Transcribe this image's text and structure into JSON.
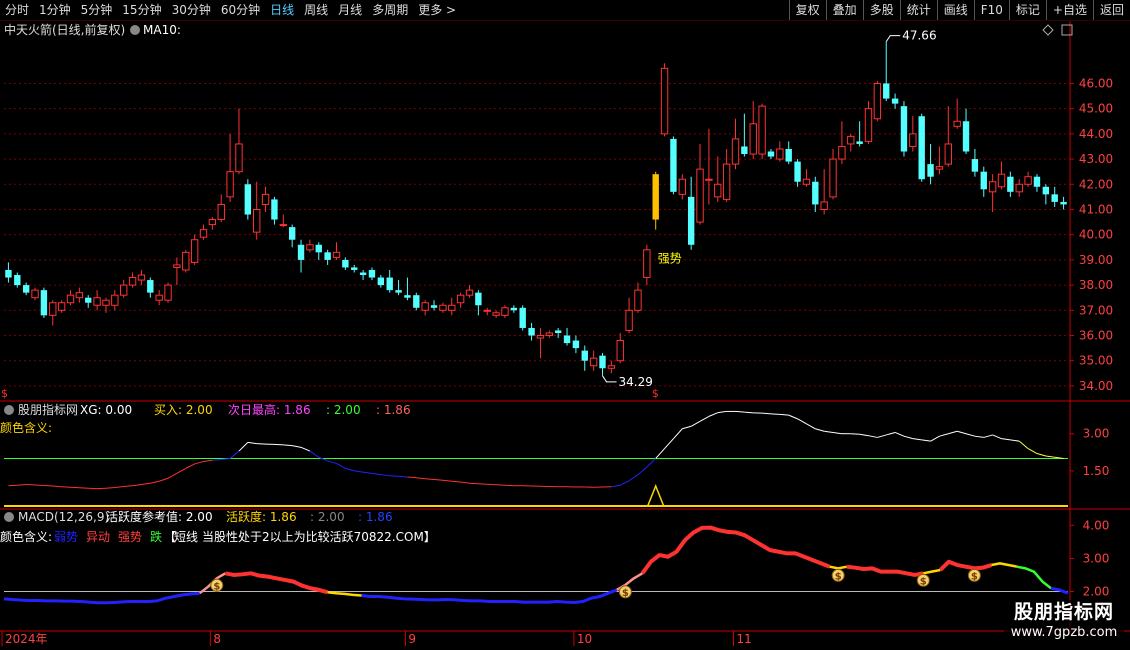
{
  "toolbar": {
    "periods": [
      "分时",
      "1分钟",
      "5分钟",
      "15分钟",
      "30分钟",
      "60分钟",
      "日线",
      "周线",
      "月线",
      "多周期",
      "更多"
    ],
    "active": "日线",
    "more_arrow": ">",
    "tools": [
      "复权",
      "叠加",
      "多股",
      "统计",
      "画线",
      "F10",
      "标记",
      "+自选",
      "返回"
    ]
  },
  "colors": {
    "up": "#ff3232",
    "down": "#54ffff",
    "bg": "#000000",
    "grid": "#7a0000",
    "axis": "#cc0000",
    "white": "#ffffff",
    "yellow": "#ffd700",
    "green": "#33ff33",
    "blue": "#2222ff",
    "pink": "#ff9090",
    "magenta": "#ff44ff"
  },
  "watermark": {
    "title": "股朋指标网",
    "url": "www.7gpzb.com"
  },
  "chart_data": [
    {
      "type": "candlestick",
      "title": "中天火箭(日线,前复权)",
      "ma_label": "MA10:",
      "ylim": [
        33.6,
        48.2
      ],
      "y_ticks": [
        34,
        35,
        36,
        37,
        38,
        39,
        40,
        41,
        42,
        43,
        44,
        45,
        46
      ],
      "high_label": "47.66",
      "low_label": "34.29",
      "signal_label": "强势",
      "dollar_marker": "$",
      "x_labels": [
        "2024年",
        "8",
        "9",
        "10",
        "11"
      ],
      "x_label_index": [
        0,
        23,
        45,
        64,
        82
      ],
      "candles": [
        [
          38.6,
          38.3,
          38.9,
          38.1
        ],
        [
          38.4,
          38.0,
          38.5,
          37.9
        ],
        [
          38.0,
          37.7,
          38.1,
          37.6
        ],
        [
          37.5,
          37.8,
          37.9,
          37.4
        ],
        [
          37.8,
          36.8,
          37.9,
          36.7
        ],
        [
          36.8,
          37.3,
          37.4,
          36.4
        ],
        [
          37.0,
          37.3,
          37.4,
          36.9
        ],
        [
          37.3,
          37.6,
          37.8,
          37.2
        ],
        [
          37.5,
          37.7,
          37.9,
          37.3
        ],
        [
          37.5,
          37.3,
          37.6,
          37.1
        ],
        [
          37.2,
          37.5,
          37.8,
          37.0
        ],
        [
          37.2,
          37.4,
          37.5,
          36.9
        ],
        [
          37.2,
          37.6,
          37.8,
          37.0
        ],
        [
          37.6,
          38.0,
          38.2,
          37.5
        ],
        [
          38.0,
          38.3,
          38.5,
          37.9
        ],
        [
          38.2,
          38.4,
          38.6,
          38.0
        ],
        [
          38.2,
          37.7,
          38.3,
          37.5
        ],
        [
          37.4,
          37.6,
          37.8,
          37.2
        ],
        [
          37.4,
          38.0,
          38.1,
          37.3
        ],
        [
          38.7,
          38.8,
          39.1,
          38.0
        ],
        [
          38.6,
          39.3,
          39.4,
          38.5
        ],
        [
          38.9,
          39.8,
          40.0,
          38.8
        ],
        [
          39.9,
          40.2,
          40.4,
          39.8
        ],
        [
          40.4,
          40.6,
          40.7,
          40.2
        ],
        [
          40.6,
          41.2,
          41.6,
          40.5
        ],
        [
          41.5,
          42.5,
          44.0,
          41.3
        ],
        [
          42.5,
          43.6,
          45.0,
          42.4
        ],
        [
          42.0,
          40.8,
          42.2,
          40.6
        ],
        [
          40.1,
          41.0,
          42.1,
          39.8
        ],
        [
          41.2,
          41.6,
          41.9,
          40.9
        ],
        [
          41.4,
          40.6,
          41.5,
          40.4
        ],
        [
          40.4,
          40.4,
          40.8,
          40.3
        ],
        [
          40.3,
          39.8,
          40.4,
          39.5
        ],
        [
          39.6,
          39.0,
          39.8,
          38.5
        ],
        [
          39.4,
          39.6,
          39.8,
          39.3
        ],
        [
          39.6,
          39.3,
          39.7,
          39.0
        ],
        [
          39.3,
          39.0,
          39.4,
          38.8
        ],
        [
          39.1,
          39.3,
          39.7,
          39.0
        ],
        [
          39.0,
          38.7,
          39.1,
          38.6
        ],
        [
          38.7,
          38.6,
          38.8,
          38.5
        ],
        [
          38.5,
          38.4,
          38.6,
          38.2
        ],
        [
          38.6,
          38.3,
          38.7,
          38.2
        ],
        [
          38.3,
          38.0,
          38.4,
          37.9
        ],
        [
          38.3,
          37.8,
          38.6,
          37.7
        ],
        [
          37.8,
          37.7,
          38.2,
          37.6
        ],
        [
          37.6,
          37.5,
          38.3,
          37.4
        ],
        [
          37.6,
          37.1,
          37.7,
          37.0
        ],
        [
          37.0,
          37.3,
          37.4,
          36.8
        ],
        [
          37.2,
          37.1,
          37.4,
          37.0
        ],
        [
          37.0,
          37.2,
          37.3,
          36.9
        ],
        [
          37.0,
          37.2,
          37.5,
          36.8
        ],
        [
          37.3,
          37.6,
          37.7,
          37.1
        ],
        [
          37.6,
          37.8,
          38.0,
          37.5
        ],
        [
          37.7,
          37.2,
          37.8,
          36.8
        ],
        [
          37.0,
          37.0,
          37.1,
          36.8
        ],
        [
          36.8,
          36.9,
          37.0,
          36.7
        ],
        [
          36.8,
          37.1,
          37.2,
          36.7
        ],
        [
          37.1,
          37.0,
          37.2,
          36.9
        ],
        [
          37.1,
          36.3,
          37.2,
          36.2
        ],
        [
          36.3,
          36.0,
          36.5,
          35.8
        ],
        [
          35.9,
          36.0,
          36.3,
          35.1
        ],
        [
          36.0,
          36.1,
          36.2,
          35.9
        ],
        [
          36.2,
          36.1,
          36.3,
          35.9
        ],
        [
          36.0,
          35.7,
          36.3,
          35.6
        ],
        [
          35.8,
          35.5,
          36.0,
          35.3
        ],
        [
          35.4,
          35.0,
          35.6,
          34.6
        ],
        [
          34.8,
          35.1,
          35.4,
          34.6
        ],
        [
          35.2,
          34.7,
          35.3,
          34.4
        ],
        [
          34.7,
          34.8,
          35.0,
          34.5
        ],
        [
          35.0,
          35.8,
          36.1,
          34.9
        ],
        [
          36.2,
          37.0,
          37.5,
          36.1
        ],
        [
          37.0,
          37.8,
          38.1,
          36.9
        ],
        [
          38.3,
          39.4,
          39.6,
          38.0
        ],
        [
          40.6,
          42.4,
          42.5,
          40.2
        ],
        [
          44.0,
          46.6,
          46.8,
          43.9
        ],
        [
          43.8,
          41.7,
          43.9,
          41.6
        ],
        [
          41.6,
          42.2,
          42.4,
          41.4
        ],
        [
          41.5,
          39.6,
          42.3,
          39.4
        ],
        [
          40.5,
          42.6,
          43.6,
          40.4
        ],
        [
          42.2,
          42.2,
          44.2,
          41.2
        ],
        [
          41.5,
          42.0,
          43.1,
          41.3
        ],
        [
          41.4,
          42.8,
          43.4,
          41.3
        ],
        [
          42.8,
          43.8,
          44.6,
          42.6
        ],
        [
          43.5,
          43.2,
          44.8,
          43.1
        ],
        [
          43.2,
          44.4,
          45.3,
          43.0
        ],
        [
          43.2,
          45.1,
          45.2,
          43.0
        ],
        [
          43.3,
          43.1,
          43.4,
          43.0
        ],
        [
          43.0,
          43.4,
          43.7,
          42.9
        ],
        [
          43.4,
          42.9,
          43.7,
          42.8
        ],
        [
          42.9,
          42.1,
          43.0,
          41.9
        ],
        [
          42.0,
          42.2,
          42.6,
          41.9
        ],
        [
          42.1,
          41.2,
          42.3,
          40.9
        ],
        [
          41.0,
          41.3,
          42.6,
          40.8
        ],
        [
          41.5,
          43.0,
          43.4,
          41.4
        ],
        [
          43.0,
          43.5,
          44.5,
          42.8
        ],
        [
          43.6,
          43.9,
          44.0,
          43.3
        ],
        [
          43.7,
          43.6,
          44.5,
          43.5
        ],
        [
          43.7,
          45.0,
          45.3,
          43.6
        ],
        [
          44.6,
          46.0,
          46.1,
          44.5
        ],
        [
          46.0,
          45.4,
          47.66,
          45.3
        ],
        [
          45.4,
          45.2,
          45.6,
          45.0
        ],
        [
          45.1,
          43.3,
          45.3,
          43.1
        ],
        [
          43.5,
          44.0,
          44.7,
          43.3
        ],
        [
          44.7,
          42.2,
          44.8,
          42.1
        ],
        [
          42.8,
          42.3,
          43.6,
          42.0
        ],
        [
          42.6,
          42.7,
          43.5,
          42.4
        ],
        [
          42.8,
          43.6,
          45.1,
          42.7
        ],
        [
          44.3,
          44.5,
          45.4,
          44.2
        ],
        [
          44.5,
          43.3,
          45.0,
          43.2
        ],
        [
          43.0,
          42.5,
          43.4,
          42.3
        ],
        [
          42.5,
          41.8,
          42.7,
          41.5
        ],
        [
          41.7,
          42.1,
          42.4,
          40.9
        ],
        [
          41.9,
          42.4,
          42.9,
          41.8
        ],
        [
          42.3,
          41.7,
          42.5,
          41.5
        ],
        [
          41.7,
          42.0,
          42.2,
          41.5
        ],
        [
          42.0,
          42.3,
          42.5,
          41.9
        ],
        [
          42.3,
          41.9,
          42.4,
          41.7
        ],
        [
          41.9,
          41.6,
          42.0,
          41.2
        ],
        [
          41.6,
          41.3,
          41.9,
          41.1
        ],
        [
          41.3,
          41.2,
          41.5,
          41.0
        ]
      ]
    },
    {
      "type": "line",
      "title": "股朋指标网",
      "legend": [
        {
          "name": "XG",
          "value": "0.00"
        },
        {
          "name": "买入",
          "value": "2.00"
        },
        {
          "name": "次日最高",
          "value": "1.86"
        },
        {
          "name": "",
          "value": "2.00"
        },
        {
          "name": "",
          "value": "1.86"
        }
      ],
      "sub_label": "颜色含义:",
      "ylim": [
        0,
        4.2
      ],
      "y_ticks": [
        1.5,
        3.0
      ],
      "baseline": 2.0,
      "buy_spike_index": 73,
      "series": [
        {
          "values": [
            0.9,
            0.92,
            0.95,
            0.93,
            0.91,
            0.89,
            0.86,
            0.84,
            0.82,
            0.8,
            0.78,
            0.8,
            0.83,
            0.87,
            0.9,
            0.95,
            1.0,
            1.08,
            1.2,
            1.4,
            1.6,
            1.78,
            1.88,
            1.93,
            1.96,
            2.0,
            2.3,
            2.65,
            2.6,
            2.58,
            2.57,
            2.55,
            2.52,
            2.45,
            2.3,
            2.05,
            1.9,
            1.8,
            1.6,
            1.5,
            1.45,
            1.4,
            1.35,
            1.3,
            1.28,
            1.25,
            1.22,
            1.18,
            1.15,
            1.12,
            1.08,
            1.05,
            1.0,
            0.98,
            0.96,
            0.94,
            0.92,
            0.9,
            0.9,
            0.89,
            0.88,
            0.87,
            0.86,
            0.86,
            0.85,
            0.85,
            0.84,
            0.85,
            0.86,
            0.92,
            1.1,
            1.35,
            1.65,
            2.0,
            2.4,
            2.8,
            3.2,
            3.3,
            3.5,
            3.7,
            3.85,
            3.9,
            3.9,
            3.87,
            3.84,
            3.83,
            3.8,
            3.78,
            3.75,
            3.6,
            3.4,
            3.2,
            3.1,
            3.05,
            3.0,
            3.0,
            2.98,
            2.92,
            2.85,
            2.95,
            3.05,
            2.9,
            2.8,
            2.75,
            2.7,
            2.9,
            3.0,
            3.1,
            3.0,
            2.9,
            2.85,
            2.95,
            2.8,
            2.75,
            2.7,
            2.4,
            2.2,
            2.1,
            2.05,
            2.0
          ]
        }
      ]
    },
    {
      "type": "line",
      "title": "MACD(12,26,9)",
      "legend": [
        {
          "name": "活跃度参考值",
          "value": "2.00"
        },
        {
          "name": "活跃度",
          "value": "1.86"
        },
        {
          "name": "",
          "value": "2.00"
        },
        {
          "name": "",
          "value": "1.86"
        }
      ],
      "sub_label": "颜色含义:",
      "color_legend": [
        "弱势",
        "异动",
        "强势",
        "跌"
      ],
      "note": "短线",
      "note2": "当股性处于2以上为比较活跃70822.COM】",
      "ylim": [
        0.9,
        4.4
      ],
      "y_ticks": [
        2.0,
        3.0,
        4.0
      ],
      "baseline": 2.0,
      "marker_indices": [
        25,
        73,
        98,
        108,
        114
      ],
      "series": [
        {
          "values": [
            1.78,
            1.76,
            1.74,
            1.73,
            1.73,
            1.72,
            1.72,
            1.71,
            1.71,
            1.7,
            1.68,
            1.66,
            1.66,
            1.67,
            1.69,
            1.7,
            1.7,
            1.7,
            1.72,
            1.8,
            1.85,
            1.9,
            1.93,
            1.95,
            2.15,
            2.4,
            2.55,
            2.5,
            2.52,
            2.55,
            2.48,
            2.45,
            2.4,
            2.35,
            2.3,
            2.18,
            2.1,
            2.05,
            1.98,
            1.95,
            1.93,
            1.9,
            1.88,
            1.85,
            1.85,
            1.83,
            1.8,
            1.78,
            1.77,
            1.76,
            1.75,
            1.75,
            1.76,
            1.75,
            1.73,
            1.72,
            1.72,
            1.7,
            1.7,
            1.7,
            1.7,
            1.68,
            1.68,
            1.68,
            1.68,
            1.7,
            1.68,
            1.67,
            1.7,
            1.8,
            1.85,
            1.95,
            2.05,
            2.2,
            2.4,
            2.55,
            2.9,
            3.1,
            3.05,
            3.2,
            3.55,
            3.78,
            3.92,
            3.93,
            3.85,
            3.8,
            3.78,
            3.7,
            3.55,
            3.4,
            3.25,
            3.2,
            3.15,
            3.15,
            3.05,
            2.95,
            2.85,
            2.75,
            2.7,
            2.75,
            2.72,
            2.68,
            2.7,
            2.6,
            2.6,
            2.6,
            2.55,
            2.5,
            2.55,
            2.6,
            2.65,
            2.9,
            2.8,
            2.75,
            2.7,
            2.72,
            2.8,
            2.85,
            2.8,
            2.75,
            2.7,
            2.6,
            2.3,
            2.1,
            2.05,
            1.95
          ]
        }
      ],
      "segments": [
        [
          0,
          23,
          "blue"
        ],
        [
          23,
          26,
          "pink"
        ],
        [
          26,
          38,
          "up"
        ],
        [
          38,
          42,
          "yellow"
        ],
        [
          42,
          72,
          "blue"
        ],
        [
          72,
          75,
          "pink"
        ],
        [
          75,
          97,
          "up"
        ],
        [
          97,
          99,
          "yellow"
        ],
        [
          99,
          108,
          "up"
        ],
        [
          108,
          110,
          "yellow"
        ],
        [
          110,
          116,
          "up"
        ],
        [
          116,
          119,
          "yellow"
        ],
        [
          119,
          123,
          "green"
        ],
        [
          123,
          125,
          "blue"
        ]
      ]
    }
  ]
}
